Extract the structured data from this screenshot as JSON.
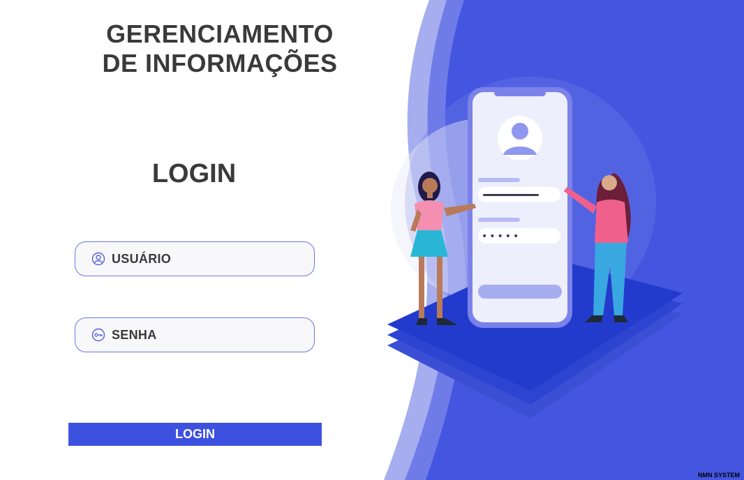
{
  "header": {
    "title_line1": "GERENCIAMENTO",
    "title_line2": "DE INFORMAÇÕES"
  },
  "form": {
    "heading": "LOGIN",
    "username": {
      "placeholder": "USUÁRIO",
      "icon": "user-icon"
    },
    "password": {
      "placeholder": "SENHA",
      "icon": "key-icon"
    },
    "submit_label": "LOGIN"
  },
  "illustration": {
    "icon": "phone-login-illustration",
    "masked_password": "•••••"
  },
  "footer": {
    "brand": "NMN SYSTEM"
  },
  "colors": {
    "accent": "#3c51e0",
    "panel": "#4456e0",
    "panel_light": "#a6aef0",
    "field_border": "#6b76e6",
    "text_dark": "#3a3a3a"
  }
}
